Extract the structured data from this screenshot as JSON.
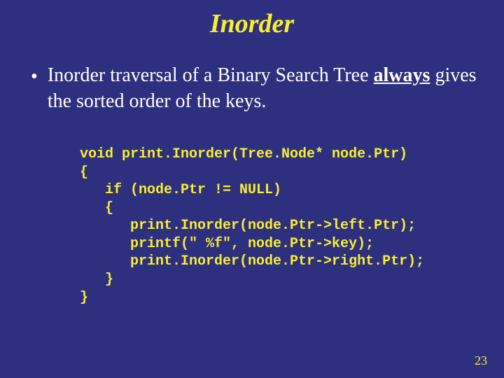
{
  "title": "Inorder",
  "bullet": {
    "dot": "•",
    "pre": "Inorder traversal of a Binary Search Tree ",
    "always": "always",
    "post": " gives the sorted order of the keys."
  },
  "code": {
    "l1": "void print.Inorder(Tree.Node* node.Ptr)",
    "l2": "{",
    "l3": "   if (node.Ptr != NULL)",
    "l4": "   {",
    "l5": "      print.Inorder(node.Ptr->left.Ptr);",
    "l6": "      printf(\" %f\", node.Ptr->key);",
    "l7": "      print.Inorder(node.Ptr->right.Ptr);",
    "l8": "   }",
    "l9": "}"
  },
  "pagenum": "23"
}
